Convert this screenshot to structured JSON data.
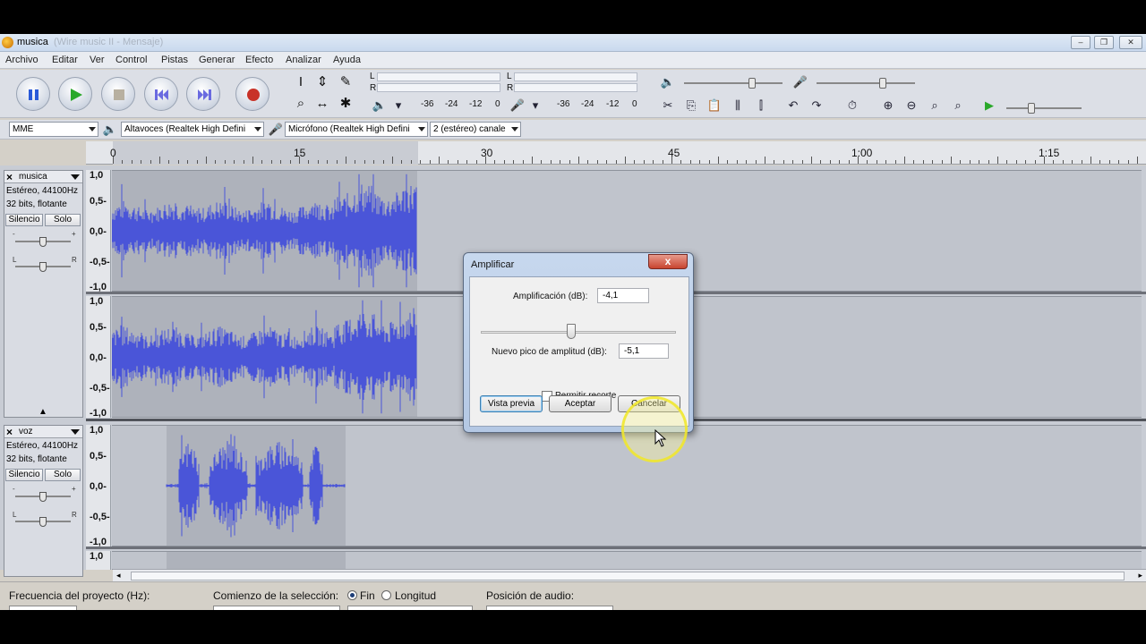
{
  "window": {
    "title": "musica",
    "title_ghost": "(Wire music II - Mensaje)",
    "controls": [
      "‒",
      "❐",
      "✕"
    ]
  },
  "menu": [
    "Archivo",
    "Editar",
    "Ver",
    "Control",
    "Pistas",
    "Generar",
    "Efecto",
    "Analizar",
    "Ayuda"
  ],
  "toolbar": {
    "meter_output": {
      "channels": [
        "L",
        "R"
      ],
      "scale": [
        "-36",
        "-24",
        "-12",
        "0"
      ]
    },
    "meter_input": {
      "channels": [
        "L",
        "R"
      ],
      "scale": [
        "-36",
        "-24",
        "-12",
        "0"
      ]
    }
  },
  "devices": {
    "host": "MME",
    "output": "Altavoces (Realtek High Defini",
    "input": "Micrófono (Realtek High Defini",
    "channels": "2 (estéreo) canale"
  },
  "ruler": {
    "labels": [
      "0",
      "15",
      "30",
      "45",
      "1:00",
      "1:15"
    ]
  },
  "tracks": [
    {
      "name": "musica",
      "info1": "Estéreo, 44100Hz",
      "info2": "32 bits, flotante",
      "mute": "Silencio",
      "solo": "Solo",
      "gain_minus": "-",
      "gain_plus": "+",
      "pan_l": "L",
      "pan_r": "R",
      "scale_top": [
        "1,0",
        "0,5-",
        "0,0-",
        "-0,5-",
        "-1,0"
      ],
      "scale_bottom": [
        "1,0",
        "0,5-",
        "0,0-",
        "-0,5-",
        "-1,0"
      ]
    },
    {
      "name": "voz",
      "info1": "Estéreo, 44100Hz",
      "info2": "32 bits, flotante",
      "mute": "Silencio",
      "solo": "Solo",
      "gain_minus": "-",
      "gain_plus": "+",
      "pan_l": "L",
      "pan_r": "R",
      "scale_top": [
        "1,0",
        "0,5-",
        "0,0-",
        "-0,5-",
        "-1,0"
      ],
      "scale_bottom_first": "1,0"
    }
  ],
  "dialog": {
    "title": "Amplificar",
    "close": "x",
    "amp_label": "Amplificación (dB):",
    "amp_value": "-4,1",
    "peak_label": "Nuevo pico de amplitud (dB):",
    "peak_value": "-5,1",
    "clip_label": "Permitir recorte",
    "clip_checked": false,
    "slider_position": 0.5,
    "preview": "Vista previa",
    "ok": "Aceptar",
    "cancel": "Cancelar"
  },
  "status": {
    "rate_label": "Frecuencia del proyecto (Hz):",
    "sel_start_label": "Comienzo de la selección:",
    "end_label": "Fin",
    "length_label": "Longitud",
    "end_selected": true,
    "audio_pos_label": "Posición de audio:"
  },
  "colors": {
    "waveform": "#4a55d8",
    "selection": "#aeb2bb",
    "background": "#c0c4cc"
  }
}
